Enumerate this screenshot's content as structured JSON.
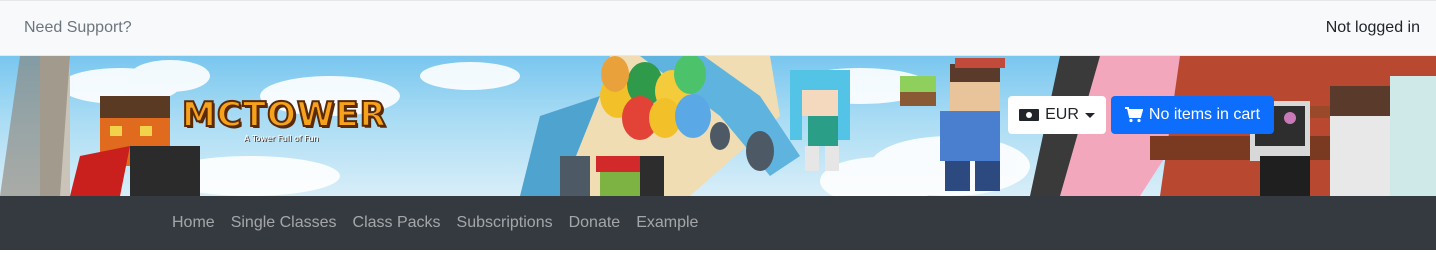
{
  "topbar": {
    "support_label": "Need Support?",
    "login_status": "Not logged in"
  },
  "banner": {
    "logo_title": "MCTOWER",
    "logo_tagline": "A Tower Full of Fun",
    "currency": {
      "icon": "cash-icon",
      "selected": "EUR",
      "caret": "chevron-down-icon"
    },
    "cart": {
      "icon": "cart-icon",
      "label": "No items in cart"
    }
  },
  "navbar": {
    "items": [
      {
        "label": "Home"
      },
      {
        "label": "Single Classes"
      },
      {
        "label": "Class Packs"
      },
      {
        "label": "Subscriptions"
      },
      {
        "label": "Donate"
      },
      {
        "label": "Example"
      }
    ]
  },
  "colors": {
    "topbar_bg": "#f8f9fa",
    "navbar_bg": "#343a40",
    "cart_button": "#0d6efd",
    "logo_orange": "#f7a21c"
  }
}
